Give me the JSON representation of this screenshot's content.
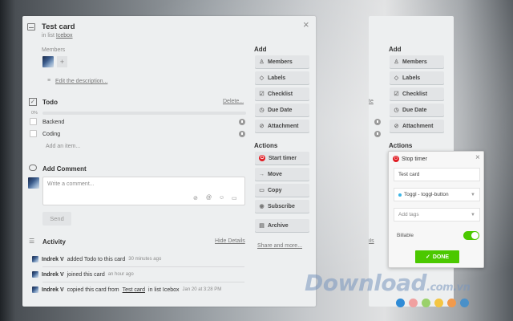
{
  "card": {
    "title": "Test card",
    "list_prefix": "in list",
    "list_name": "Icebox",
    "members_label": "Members",
    "add_member": "+",
    "edit_description": "Edit the description...",
    "checklist": {
      "title": "Todo",
      "delete": "Delete...",
      "percent": "0%",
      "progress": 0,
      "items": [
        "Backend",
        "Coding"
      ],
      "add_item": "Add an item..."
    },
    "comment": {
      "title": "Add Comment",
      "placeholder": "Write a comment...",
      "send": "Send"
    },
    "activity": {
      "title": "Activity",
      "hide_details": "Hide Details",
      "rows": [
        {
          "user": "Indrek V",
          "text": "added Todo to this card",
          "time": "30 minutes ago"
        },
        {
          "user": "Indrek V",
          "text": "joined this card",
          "time": "an hour ago"
        },
        {
          "user": "Indrek V",
          "text": "copied this card from",
          "link": "Test card",
          "text2": "in list Icebox",
          "time": "Jan 20 at 3:28 PM"
        }
      ]
    }
  },
  "sidebar": {
    "add_title": "Add",
    "add_buttons": [
      "Members",
      "Labels",
      "Checklist",
      "Due Date",
      "Attachment"
    ],
    "actions_title": "Actions",
    "action_buttons": [
      "Start timer",
      "Move",
      "Copy",
      "Subscribe",
      "Archive"
    ],
    "share_more": "Share and more..."
  },
  "sidebar2": {
    "add_title": "Add",
    "add_buttons": [
      "Members",
      "Labels",
      "Checklist",
      "Due Date",
      "Attachment"
    ],
    "actions_title": "Actions"
  },
  "toggl": {
    "stop_label": "Stop timer",
    "description": "Test card",
    "project": "Toggl - toggl-button",
    "tags_placeholder": "Add tags",
    "billable_label": "Billable",
    "billable": true,
    "done": "DONE",
    "close": "×"
  },
  "watermark": {
    "text": "Download",
    "suffix": ".com.vn"
  },
  "colors": {
    "accent_green": "#4bc800",
    "toggl_red": "#e01b22",
    "project_dot": "#3cb5e6",
    "dots": [
      "#2f8bd6",
      "#f0a0a0",
      "#9ad16b",
      "#f4c542",
      "#f29a4c",
      "#4a90c8"
    ]
  }
}
